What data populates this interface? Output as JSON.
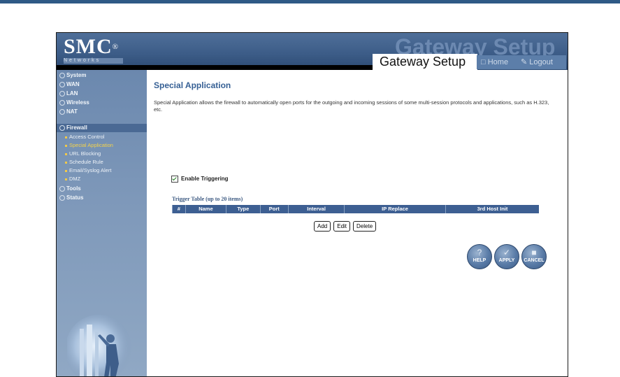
{
  "header": {
    "logo": "SMC",
    "logo_reg": "®",
    "logo_sub": "Networks",
    "ghost_title": "Gateway Setup",
    "title": "Gateway Setup",
    "home_label": "Home",
    "logout_label": "Logout"
  },
  "sidebar": {
    "items": [
      {
        "label": "System"
      },
      {
        "label": "WAN"
      },
      {
        "label": "LAN"
      },
      {
        "label": "Wireless"
      },
      {
        "label": "NAT"
      },
      {
        "label": "Firewall",
        "active": true
      },
      {
        "label": "Tools"
      },
      {
        "label": "Status"
      }
    ],
    "firewall_sub": [
      {
        "label": "Access Control"
      },
      {
        "label": "Special Application",
        "selected": true
      },
      {
        "label": "URL Blocking"
      },
      {
        "label": "Schedule Rule"
      },
      {
        "label": "Email/Syslog Alert"
      },
      {
        "label": "DMZ"
      }
    ]
  },
  "main": {
    "title": "Special Application",
    "description": "Special Application allows the firewall to automatically open ports for the outgoing and incoming sessions of some multi-session protocols and applications, such as H.323, etc.",
    "enable_label": "Enable Triggering",
    "enable_checked": true,
    "table_caption": "Trigger Table (up to 20 items)",
    "table_headers": [
      "#",
      "Name",
      "Type",
      "Port",
      "Interval",
      "IP Replace",
      "3rd Host Init"
    ],
    "buttons": {
      "add": "Add",
      "edit": "Edit",
      "delete": "Delete"
    },
    "actions": {
      "help": "HELP",
      "apply": "APPLY",
      "cancel": "CANCEL"
    }
  },
  "colors": {
    "header": "#3d5d88",
    "sidebar": "#7f99ba",
    "title": "#355f94",
    "table_header": "#3d5f92",
    "selected_sub": "#f4d24a"
  }
}
